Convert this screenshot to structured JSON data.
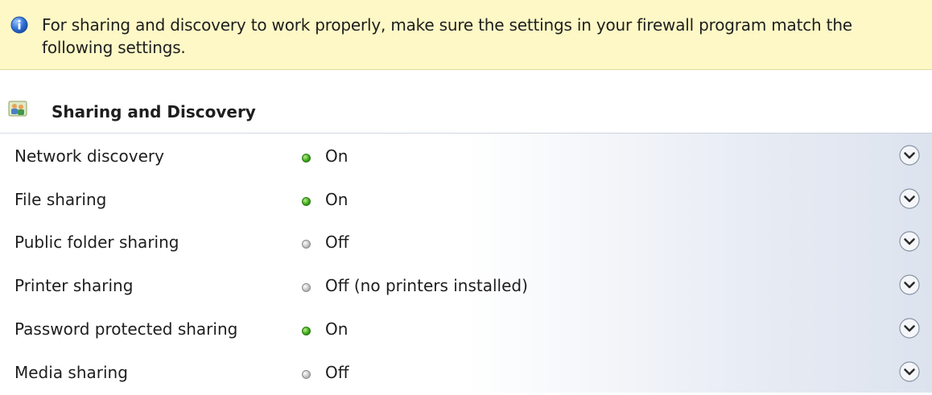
{
  "info_bar": {
    "icon": "info-icon",
    "text": "For sharing and discovery to work properly, make sure the settings in your firewall program match the following settings."
  },
  "section": {
    "icon": "people-group-icon",
    "title": "Sharing and Discovery"
  },
  "settings": [
    {
      "label": "Network discovery",
      "status": "On",
      "state": "on"
    },
    {
      "label": "File sharing",
      "status": "On",
      "state": "on"
    },
    {
      "label": "Public folder sharing",
      "status": "Off",
      "state": "off"
    },
    {
      "label": "Printer sharing",
      "status": "Off (no printers installed)",
      "state": "off"
    },
    {
      "label": "Password protected sharing",
      "status": "On",
      "state": "on"
    },
    {
      "label": "Media sharing",
      "status": "Off",
      "state": "off"
    }
  ],
  "colors": {
    "info_background": "#fdf8c6",
    "status_on": "#3ea81c",
    "status_off": "#bdbdbd"
  }
}
